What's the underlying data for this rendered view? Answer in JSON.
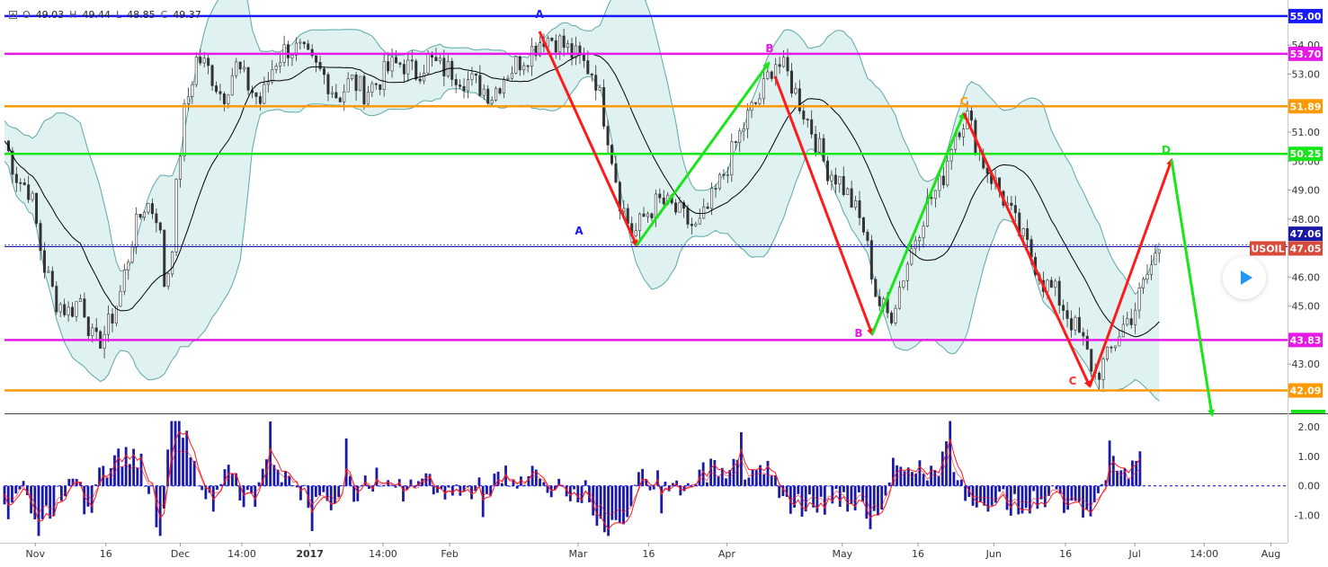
{
  "ohlc": {
    "o_label": "O",
    "o_value": "49.03",
    "h_label": "H",
    "h_value": "49.44",
    "l_label": "L",
    "l_value": "48.85",
    "c_label": "C",
    "c_value": "49.37"
  },
  "chart_data": {
    "type": "candlestick",
    "symbol": "USOIL",
    "last_price": "47.05",
    "crosshair_price": "47.06",
    "price_axis": {
      "range": [
        41.3,
        55.4
      ],
      "ticks": [
        "54.00",
        "53.00",
        "51.00",
        "50.00",
        "49.00",
        "48.00",
        "46.00",
        "45.00",
        "43.00"
      ]
    },
    "time_axis": {
      "labels": [
        "Nov",
        "16",
        "Dec",
        "14:00",
        "2017",
        "14:00",
        "Feb",
        "Mar",
        "16",
        "Apr",
        "May",
        "16",
        "Jun",
        "16",
        "Jul",
        "14:00",
        "Aug"
      ],
      "bold_labels": [
        "2017"
      ]
    },
    "price_levels": [
      {
        "price": 55.0,
        "label": "55.00",
        "color": "#1a1aff"
      },
      {
        "price": 53.7,
        "label": "53.70",
        "color": "#e619e6"
      },
      {
        "price": 51.89,
        "label": "51.89",
        "color": "#ff9900"
      },
      {
        "price": 50.25,
        "label": "50.25",
        "color": "#19e619"
      },
      {
        "price": 43.83,
        "label": "43.83",
        "color": "#e619e6"
      },
      {
        "price": 42.09,
        "label": "42.09",
        "color": "#ff9900"
      }
    ],
    "price_path": [
      [
        0,
        50.7
      ],
      [
        0.01,
        49.4
      ],
      [
        0.02,
        49.0
      ],
      [
        0.03,
        46.5
      ],
      [
        0.04,
        45.2
      ],
      [
        0.05,
        44.8
      ],
      [
        0.06,
        45.3
      ],
      [
        0.07,
        43.6
      ],
      [
        0.08,
        44.2
      ],
      [
        0.09,
        45.4
      ],
      [
        0.1,
        47.4
      ],
      [
        0.11,
        48.6
      ],
      [
        0.12,
        48.1
      ],
      [
        0.125,
        45.6
      ],
      [
        0.13,
        46.8
      ],
      [
        0.135,
        49.6
      ],
      [
        0.14,
        51.6
      ],
      [
        0.15,
        53.6
      ],
      [
        0.16,
        53.1
      ],
      [
        0.17,
        52.2
      ],
      [
        0.18,
        53.3
      ],
      [
        0.19,
        52.6
      ],
      [
        0.2,
        52.0
      ],
      [
        0.21,
        53.4
      ],
      [
        0.22,
        53.9
      ],
      [
        0.23,
        53.8
      ],
      [
        0.24,
        53.3
      ],
      [
        0.25,
        52.9
      ],
      [
        0.26,
        52.2
      ],
      [
        0.27,
        52.8
      ],
      [
        0.28,
        52.4
      ],
      [
        0.29,
        52.7
      ],
      [
        0.3,
        53.2
      ],
      [
        0.31,
        53.4
      ],
      [
        0.32,
        53.0
      ],
      [
        0.33,
        53.5
      ],
      [
        0.34,
        53.2
      ],
      [
        0.35,
        53.1
      ],
      [
        0.36,
        52.8
      ],
      [
        0.37,
        52.6
      ],
      [
        0.38,
        52.3
      ],
      [
        0.39,
        53.0
      ],
      [
        0.4,
        53.4
      ],
      [
        0.41,
        53.8
      ],
      [
        0.42,
        54.3
      ],
      [
        0.43,
        54.2
      ],
      [
        0.44,
        53.8
      ],
      [
        0.45,
        53.4
      ],
      [
        0.46,
        53.0
      ],
      [
        0.47,
        51.0
      ],
      [
        0.48,
        48.6
      ],
      [
        0.49,
        47.4
      ],
      [
        0.5,
        48.2
      ],
      [
        0.51,
        48.6
      ],
      [
        0.52,
        48.4
      ],
      [
        0.53,
        48.0
      ],
      [
        0.54,
        47.6
      ],
      [
        0.55,
        48.5
      ],
      [
        0.56,
        49.5
      ],
      [
        0.57,
        50.6
      ],
      [
        0.58,
        51.6
      ],
      [
        0.59,
        52.3
      ],
      [
        0.6,
        53.5
      ],
      [
        0.61,
        53.0
      ],
      [
        0.62,
        52.0
      ],
      [
        0.63,
        51.0
      ],
      [
        0.64,
        49.8
      ],
      [
        0.65,
        49.4
      ],
      [
        0.66,
        48.6
      ],
      [
        0.67,
        47.6
      ],
      [
        0.68,
        45.2
      ],
      [
        0.69,
        44.6
      ],
      [
        0.7,
        46.0
      ],
      [
        0.71,
        47.4
      ],
      [
        0.72,
        48.6
      ],
      [
        0.73,
        49.2
      ],
      [
        0.74,
        51.0
      ],
      [
        0.75,
        51.6
      ],
      [
        0.76,
        50.2
      ],
      [
        0.77,
        49.4
      ],
      [
        0.78,
        48.6
      ],
      [
        0.79,
        47.6
      ],
      [
        0.8,
        46.8
      ],
      [
        0.81,
        45.8
      ],
      [
        0.82,
        45.4
      ],
      [
        0.83,
        44.6
      ],
      [
        0.84,
        43.8
      ],
      [
        0.85,
        42.6
      ],
      [
        0.86,
        43.2
      ],
      [
        0.87,
        44.2
      ],
      [
        0.88,
        44.8
      ],
      [
        0.89,
        46.0
      ],
      [
        0.9,
        47.05
      ]
    ],
    "indicator": {
      "axis_ticks": [
        "2.00",
        "1.00",
        "0.00",
        "-1.00"
      ],
      "range": [
        -1.9,
        2.4
      ],
      "zero_line_color": "#1a1aff"
    },
    "annotations": [
      {
        "text": "A",
        "color": "#1a1aff"
      },
      {
        "text": "A",
        "color": "#1a1aff"
      },
      {
        "text": "B",
        "color": "#e619e6"
      },
      {
        "text": "B",
        "color": "#e619e6"
      },
      {
        "text": "C",
        "color": "#ff9900"
      },
      {
        "text": "C",
        "color": "#ff3333"
      },
      {
        "text": "D",
        "color": "#19e619"
      }
    ],
    "colors": {
      "up_arrow": "#19e619",
      "down_arrow": "#ff1a1a",
      "band": "#5aa8a8",
      "band_fill": "#d6ecec",
      "ma": "#000000",
      "hist": "#1a1aa6",
      "signal": "#ff1a1a",
      "symbol_label": "#d84b3a"
    }
  }
}
